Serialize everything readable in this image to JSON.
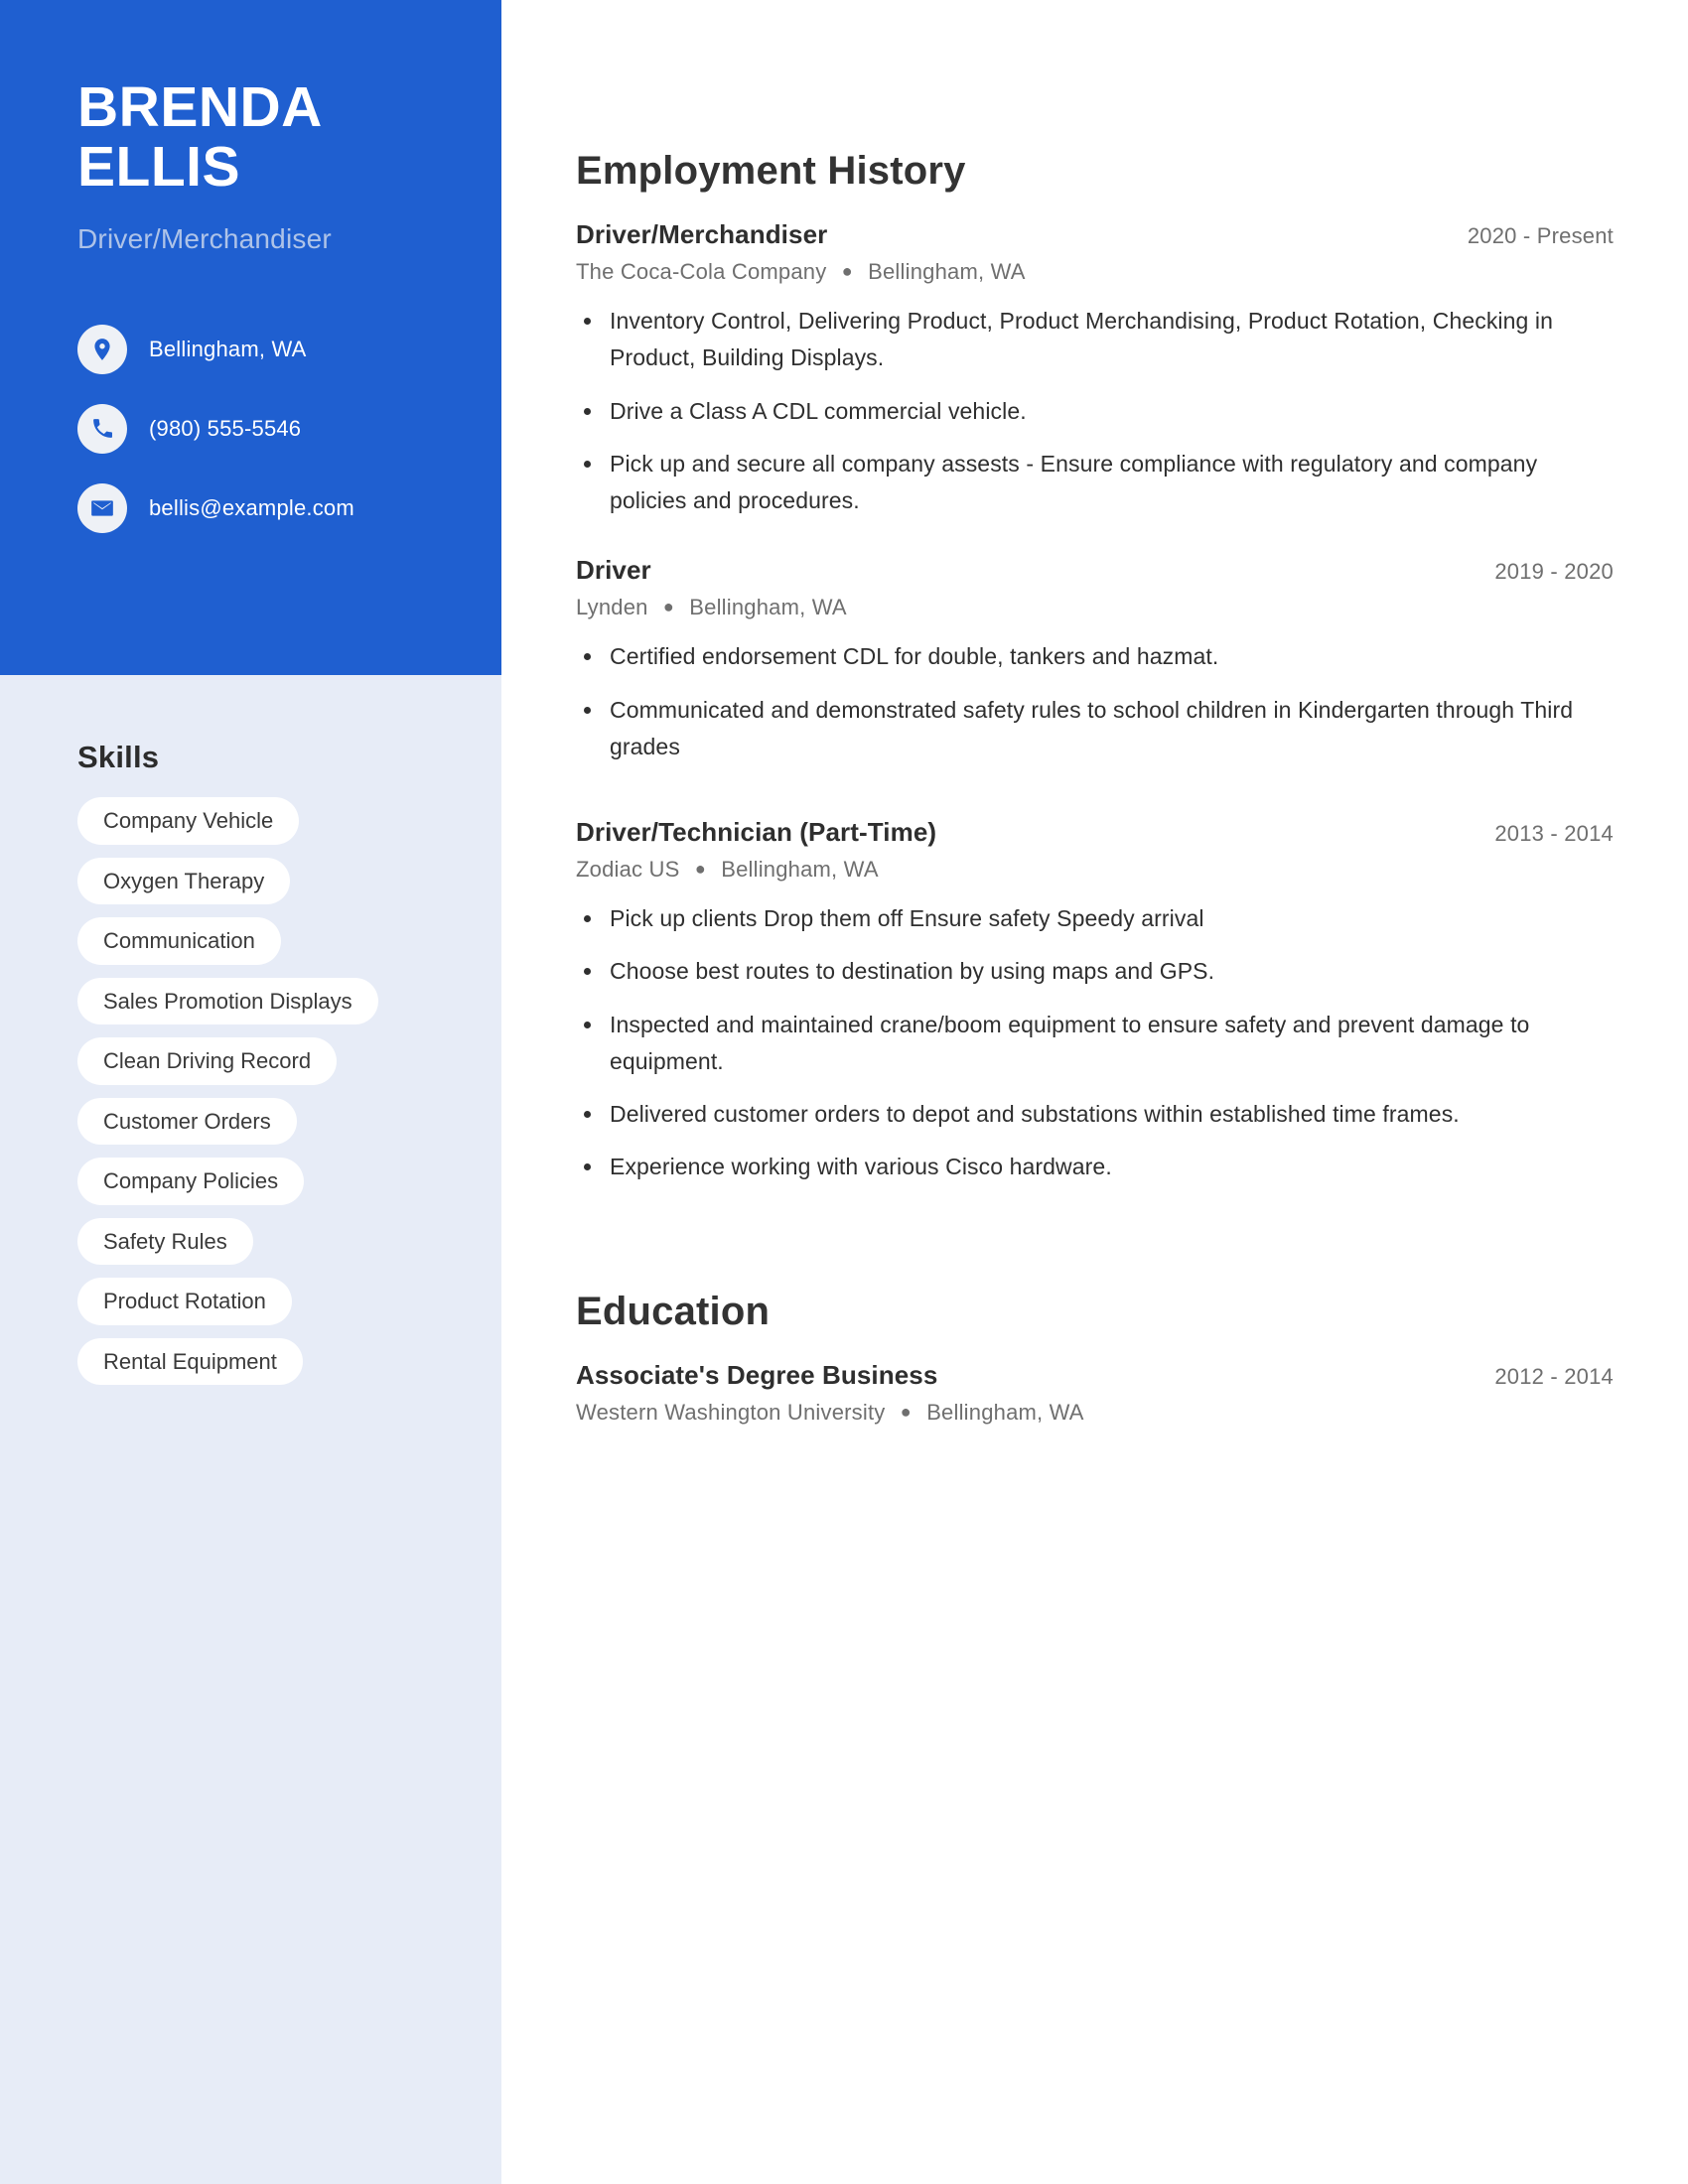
{
  "profile": {
    "first_name": "BRENDA",
    "last_name": "ELLIS",
    "headline": "Driver/Merchandiser"
  },
  "contact": {
    "items": [
      {
        "icon": "location-pin-icon",
        "value": "Bellingham, WA"
      },
      {
        "icon": "phone-icon",
        "value": "(980) 555-5546"
      },
      {
        "icon": "envelope-icon",
        "value": "bellis@example.com"
      }
    ]
  },
  "skills": {
    "heading": "Skills",
    "items": [
      "Company Vehicle",
      "Oxygen Therapy",
      "Communication",
      "Sales Promotion Displays",
      "Clean Driving Record",
      "Customer Orders",
      "Company Policies",
      "Safety Rules",
      "Product Rotation",
      "Rental Equipment"
    ]
  },
  "employment": {
    "heading": "Employment History",
    "entries": [
      {
        "role": "Driver/Merchandiser",
        "dates": "2020 - Present",
        "company": "The Coca-Cola Company",
        "location": "Bellingham, WA",
        "bullets": [
          "Inventory Control, Delivering Product, Product Merchandising, Product Rotation, Checking in Product, Building Displays.",
          "Drive a Class A CDL commercial vehicle.",
          "Pick up and secure all company assests - Ensure compliance with regulatory and company policies and procedures."
        ]
      },
      {
        "role": "Driver",
        "dates": "2019 - 2020",
        "company": "Lynden",
        "location": "Bellingham, WA",
        "bullets": [
          "Certified endorsement CDL for double, tankers and hazmat.",
          "Communicated and demonstrated safety rules to school children in Kindergarten through Third grades"
        ]
      },
      {
        "role": "Driver/Technician (Part-Time)",
        "dates": "2013 - 2014",
        "company": "Zodiac US",
        "location": "Bellingham, WA",
        "bullets": [
          "Pick up clients Drop them off Ensure safety Speedy arrival",
          "Choose best routes to destination by using maps and GPS.",
          "Inspected and maintained crane/boom equipment to ensure safety and prevent damage to equipment.",
          "Delivered customer orders to depot and substations within established time frames.",
          "Experience working with various Cisco hardware."
        ]
      }
    ]
  },
  "education": {
    "heading": "Education",
    "entries": [
      {
        "degree": "Associate's Degree Business",
        "dates": "2012 - 2014",
        "school": "Western Washington University",
        "location": "Bellingham, WA"
      }
    ]
  },
  "colors": {
    "brand_blue": "#1f5fd0",
    "sidebar_light": "#e7ecf7",
    "headline_muted": "#aec3e8"
  }
}
